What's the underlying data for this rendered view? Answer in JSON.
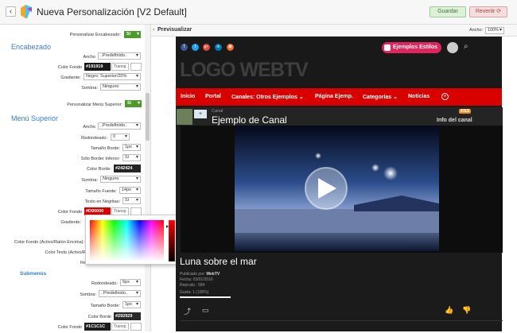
{
  "header": {
    "title": "Nueva Personalización  [V2 Default]",
    "save": "Guardar",
    "revert": "Revertir",
    "back_icon": "chevron-left-icon"
  },
  "settings": {
    "custom_header_label": "Personalizar Encabezado:",
    "custom_header_value": "Sí",
    "section_header": "Encabezado",
    "ancho_label": "Ancho",
    "ancho_value": "..Predefinido..",
    "color_fondo_label": "Color Fondo",
    "color_fondo_value": "#191919",
    "transp": "Transp.",
    "gradiente_label": "Gradiente:",
    "gradiente_value": "Negro: Superior/20%",
    "sombra_label": "Sombra:",
    "sombra_value": "Ninguno",
    "custom_menu_label": "Personalizar Menú Superior:",
    "custom_menu_value": "Sí",
    "section_menu": "Menú Superior",
    "m_ancho_label": "Ancho",
    "m_ancho_value": "..Predefinido..",
    "redondeado_label": "Redondeado:",
    "redondeado_value": "0",
    "tam_borde_label": "Tamaño Borde:",
    "tam_borde_value": "1px",
    "solo_borde_label": "Sólo Border Inferior:",
    "solo_borde_value": "Sí",
    "color_borde_label": "Color Borde:",
    "color_borde_value": "#242424",
    "m_sombra_label": "Sombra:",
    "m_sombra_value": "Ninguno",
    "tam_fuente_label": "Tamaño Fuente:",
    "tam_fuente_value": "14px",
    "negritas_label": "Texto en Negritas:",
    "negritas_value": "Sí",
    "m_color_fondo_label": "Color Fondo",
    "m_color_fondo_value": "#D90000",
    "m_gradiente_label": "Gradiente:",
    "fondo_activo_label": "Color Fondo (Activo/Ratón Encima):",
    "texto_activo_label": "Color Texto (Activo/R",
    "re_label": "Re",
    "section_submenu": "Submenús",
    "s_redondeado_label": "Redondeado:",
    "s_redondeado_value": "5px",
    "s_sombra_label": "Sombra:",
    "s_sombra_value": "..Predefinido..",
    "s_tam_borde_label": "Tamaño Borde:",
    "s_tam_borde_value": "1px",
    "s_color_borde_label": "Color Borde",
    "s_color_borde_value": "#292929",
    "s_color_fondo_label": "Color Fondo",
    "s_color_fondo_value": "#1C1C1C"
  },
  "colors": {
    "header_bg": "#191919",
    "menu_bg": "#D90000",
    "border": "#242424",
    "sub_border": "#292929",
    "sub_bg": "#1C1C1C",
    "green": "#4c9a2a"
  },
  "preview": {
    "label": "Previsualizar",
    "width_label": "Ancho:",
    "width_value": "100%",
    "site_logo": "LOGO WEBTV",
    "social_icons": [
      "facebook-icon",
      "twitter-icon",
      "googleplus-icon",
      "linkedin-icon",
      "rss-icon"
    ],
    "styles_button": "Ejemplos Estilos",
    "menu": [
      "Inicio",
      "Portal",
      "Canales: Otros Ejemplos",
      "Página Ejemp.",
      "Categorías",
      "Noticias"
    ],
    "menu_has_dropdown": [
      false,
      false,
      true,
      false,
      true,
      false
    ],
    "channel_small": "Canal",
    "channel_name": "Ejemplo de Canal",
    "rss": "RSS",
    "info": "Info del canal",
    "video_title": "Luna sobre el mar",
    "published_by_label": "Publicado por:",
    "published_by": "WebTV",
    "date": "Fecha: 03/01/2016",
    "plays": "Reprods.: 584",
    "likes": "Gusta: 1 (100%)"
  }
}
